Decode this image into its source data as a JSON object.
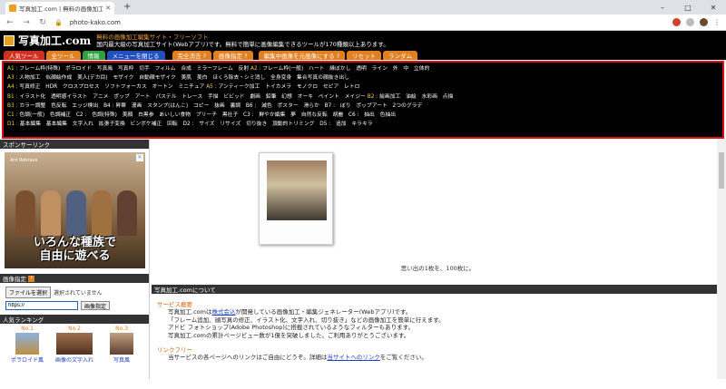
{
  "browser": {
    "tab_title": "写真加工.com | 無料の画像加工Wi",
    "new_tab": "+",
    "url": "photo-kako.com",
    "window": {
      "minimize": "–",
      "maximize": "□",
      "close": "✕"
    }
  },
  "header": {
    "logo_text": "写真加工.com",
    "tagline1": "無料の画像加工編集サイト・フリーソフト",
    "tagline2": "国内最大級の写真加工サイト(Webアプリ)です。無料で簡単に画像編集できるツールが170種類以上あります。"
  },
  "tabs": [
    {
      "label": "人気ツール"
    },
    {
      "label": "全ツール"
    },
    {
      "label": "情報"
    },
    {
      "label": "メニューを閉じる"
    },
    {
      "label": "完全消去 ?"
    },
    {
      "label": "画像指定 ?"
    },
    {
      "label": "編集中画像を元画像にする ?"
    },
    {
      "label": "リセット"
    },
    {
      "label": "ランダム"
    }
  ],
  "categories": [
    {
      "code": "A1 :",
      "items": "フレーム枠(特殊)　ポラロイド　写真風　写真枠　切手　フィルム　合成　ミラーフレーム　反射"
    },
    {
      "code": "A2 :",
      "items": "フレーム枠(一般)　ハート　縁ぼかし　透明　ライン　外　中　立体的"
    },
    {
      "code": "A3 :",
      "items": "人物加工　似顔絵作成　美人(デカ目)　モザイク　自動顔モザイク　美肌　美白　ほくろ除去・シミ消し　全身変身　集合写真の顔抜き出し"
    },
    {
      "code": "A4 :",
      "items": "写真修正　HDR　クロスプロセス　ソフトフォーカス　オートン　ミニチュア"
    },
    {
      "code": "A5 :",
      "items": "アンティーク加工　トイカメラ　モノクロ　セピア　レトロ"
    },
    {
      "code": "B1 :",
      "items": "イラスト化　透明感イラスト　アニメ　ポップ　アート　パステル　トレース　手描　ビビッド　劇画　鉛筆　幻想　オーキ　ペイント　メイジー"
    },
    {
      "code": "B2 :",
      "items": "絵画加工　油絵　水彩画　点描"
    },
    {
      "code": "B3 :",
      "items": "カラー調整　色反転　エッジ検出　B4 :"
    },
    {
      "code": "",
      "items": "昇華　漫画　スタンプ(はんこ)　コピー　抜画　裏調　B6 :　減色　ポスター　滑らか　B7 :　ぼり　ポップアート　2つのグラデ"
    },
    {
      "code": "C1 :",
      "items": "色調(一般)　色調補正　C2 :　色調(特殊)　美顔　白黒参　あいしい食物　ブリーチ　黒社子　C3 :　鮮やか編集　夢　自然な反転　胡麗　C6 :　抽出　色抽出"
    },
    {
      "code": "D1 :",
      "items": "基本編集　基本編集　文字入れ　拡張子変換　ビンボケ補正　回転　D2 :　サイズ　リサイズ　切り抜き　頂動的トリミング　D5 :　追加　キラキラ"
    }
  ],
  "sidebar": {
    "sponsor_title": "スポンサーリンク",
    "ad": {
      "logo": "Ark Rebrave",
      "text_line1": "いろんな種族で",
      "text_line2": "自由に遊べる"
    },
    "img_spec_title": "画像指定",
    "file_button": "ファイルを選択",
    "file_status": "選択されていません",
    "url_value": "https://",
    "spec_button": "画像指定",
    "ranking_title": "人気ランキング",
    "ranking": [
      {
        "no": "No.1",
        "name": "ポラロイド風"
      },
      {
        "no": "No.2",
        "name": "画像の文字入れ"
      },
      {
        "no": "No.3",
        "name": "写真風"
      }
    ]
  },
  "main": {
    "caption": "思い出の1枚を、100枚に。",
    "about_title": "写真加工.comについて",
    "service_title": "サービス概要",
    "service_lines": [
      "写真加工.comは",
      "株式会込",
      "が開発している画像加工・編集ジェネレーター(Webアプリ)です。",
      "「フレーム追加、顔写真の修正、イラスト化、文字入れ、切り抜き」などの画像加工を簡単に行えます。",
      "アドビ フォトショップ(Adobe Photoshop)に搭載されているようなフィルターもあります。",
      "写真加工.comの累計ページビュー数が1億を突破しました。ご利用ありがとうございます。"
    ],
    "link_title": "リンクフリー",
    "link_line_a": "当サービスの各ページへのリンクはご自由にどうぞ。詳細は",
    "link_line_link": "当サイトへのリンク",
    "link_line_b": "をご覧ください。"
  }
}
